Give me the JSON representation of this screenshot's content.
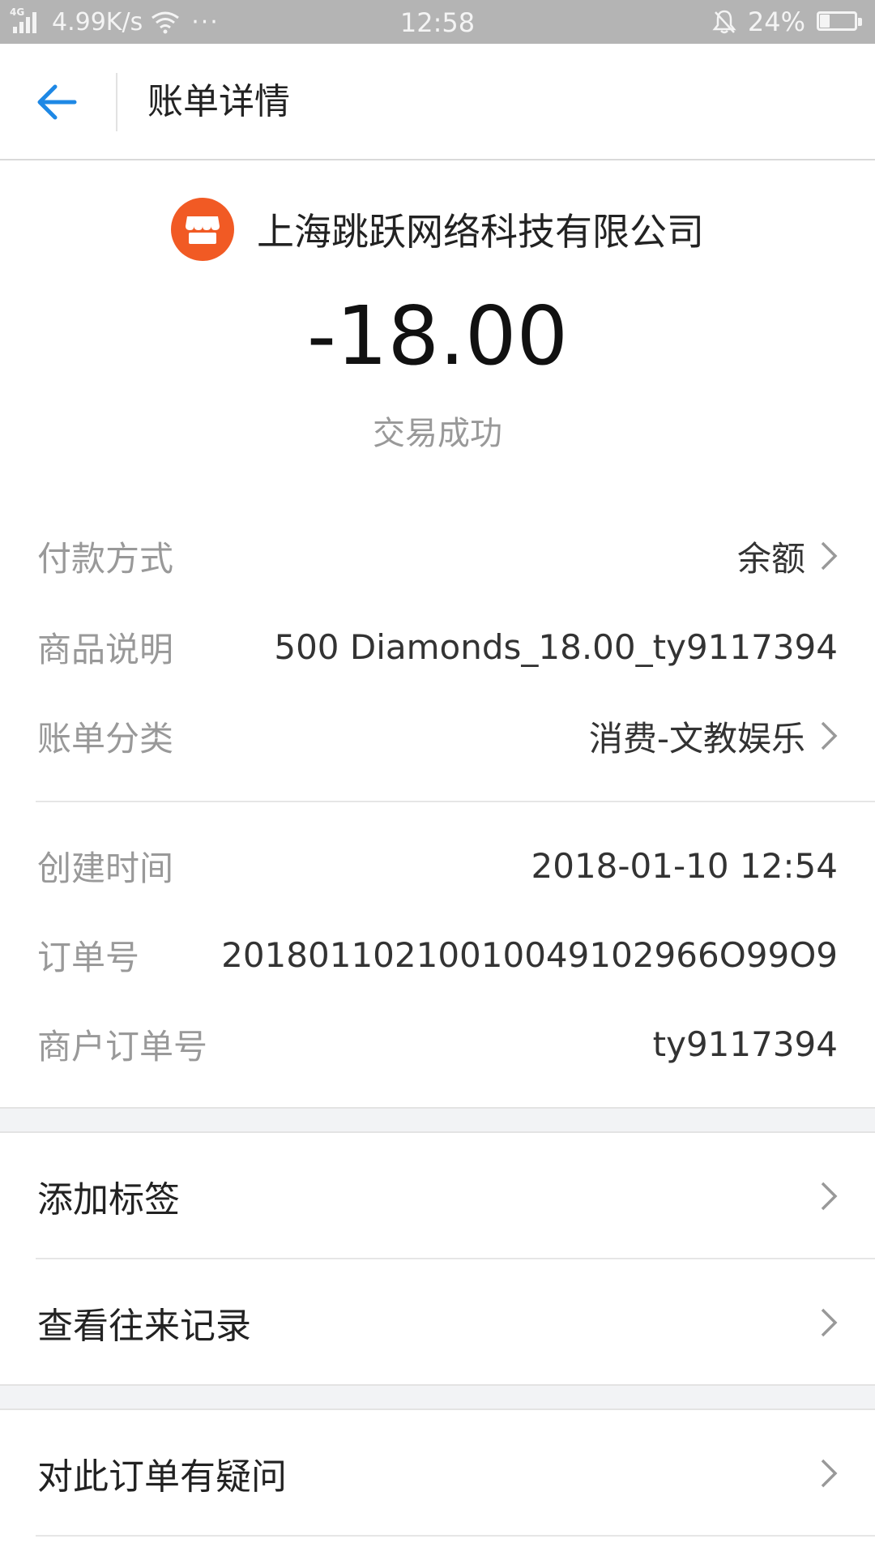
{
  "status_bar": {
    "network": "4G",
    "speed": "4.99K/s",
    "dots": "···",
    "time": "12:58",
    "battery": "24%"
  },
  "header": {
    "title": "账单详情"
  },
  "merchant": {
    "name": "上海跳跃网络科技有限公司",
    "icon": "shop-icon",
    "icon_color": "#f15a24"
  },
  "amount": "-18.00",
  "status": "交易成功",
  "details": {
    "payment_method": {
      "label": "付款方式",
      "value": "余额"
    },
    "product_desc": {
      "label": "商品说明",
      "value": "500 Diamonds_18.00_ty9117394"
    },
    "category": {
      "label": "账单分类",
      "value": "消费-文教娱乐"
    },
    "created_time": {
      "label": "创建时间",
      "value": "2018-01-10 12:54"
    },
    "order_no": {
      "label": "订单号",
      "value": "20180110210010049102966O99O9"
    },
    "merchant_order_no": {
      "label": "商户订单号",
      "value": "ty9117394"
    }
  },
  "actions": {
    "add_tag": "添加标签",
    "view_history": "查看往来记录",
    "question": "对此订单有疑问"
  },
  "colors": {
    "accent": "#1e88e5",
    "merchant_icon": "#f15a24"
  }
}
